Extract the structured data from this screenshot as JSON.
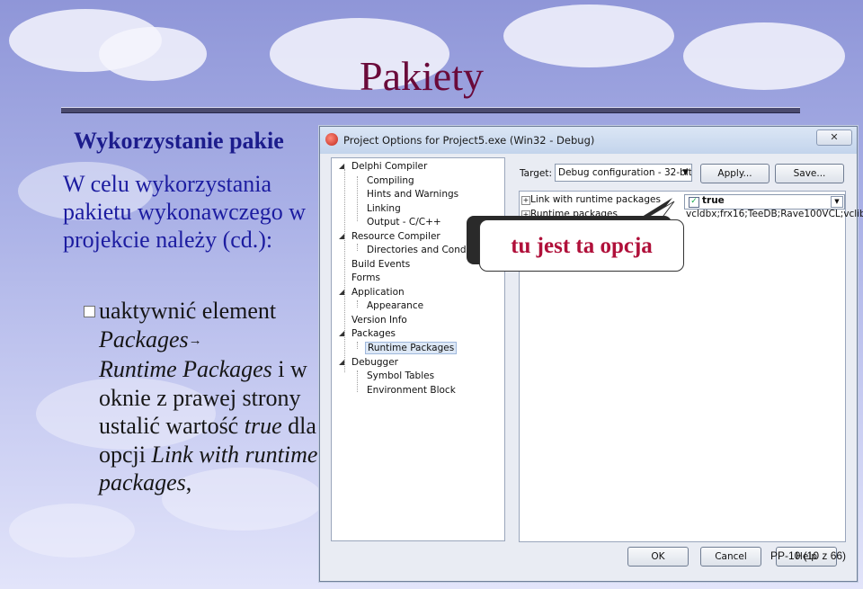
{
  "slide": {
    "title": "Pakiety",
    "subtitle": "Wykorzystanie pakie",
    "intro": "W celu wykorzystania pakietu wykonawczego w projekcie należy (cd.):",
    "bullet": {
      "part1": "uaktywnić element ",
      "part2_italic": "Packages",
      "arrow": "→",
      "part3_italic": "Runtime Packages",
      "part4": " i w oknie z prawej strony ustalić wartość ",
      "part5_italic": "true",
      "part6": " dla opcji ",
      "part7_italic": "Link with runtime packages",
      "part8": ","
    },
    "footer": "PP-10 (10 z 66)",
    "colors": {
      "title": "#6a0a3a",
      "subtitle": "#1c1c8c",
      "callout": "#b0103a"
    }
  },
  "dialog": {
    "title": "Project Options for Project5.exe  (Win32 - Debug)",
    "close_glyph": "✕",
    "tree": [
      {
        "label": "Delphi Compiler",
        "expander": "▲"
      },
      {
        "label": "Compiling"
      },
      {
        "label": "Hints and Warnings"
      },
      {
        "label": "Linking"
      },
      {
        "label": "Output - C/C++"
      },
      {
        "label": "Resource Compiler",
        "expander": "▲"
      },
      {
        "label": "Directories and Conditionals"
      },
      {
        "label": "Build Events"
      },
      {
        "label": "Forms"
      },
      {
        "label": "Application",
        "expander": "▲"
      },
      {
        "label": "Appearance"
      },
      {
        "label": "Version Info"
      },
      {
        "label": "Packages",
        "expander": "▲"
      },
      {
        "label": "Runtime Packages"
      },
      {
        "label": "Debugger",
        "expander": "▲"
      },
      {
        "label": "Symbol Tables"
      },
      {
        "label": "Environment Block"
      }
    ],
    "target_label": "Target:",
    "target_value": "Debug configuration - 32-bit \\",
    "apply_label": "Apply...",
    "save_label": "Save...",
    "properties": [
      {
        "name": "Link with runtime packages",
        "value": "true",
        "checked": true
      },
      {
        "name": "Runtime packages",
        "value": "vcldbx;frx16;TeeDB;Rave100VCL;vclib"
      }
    ],
    "ok_label": "OK",
    "cancel_label": "Cancel",
    "help_label": "Help"
  },
  "callout": {
    "text": "tu jest ta opcja"
  }
}
